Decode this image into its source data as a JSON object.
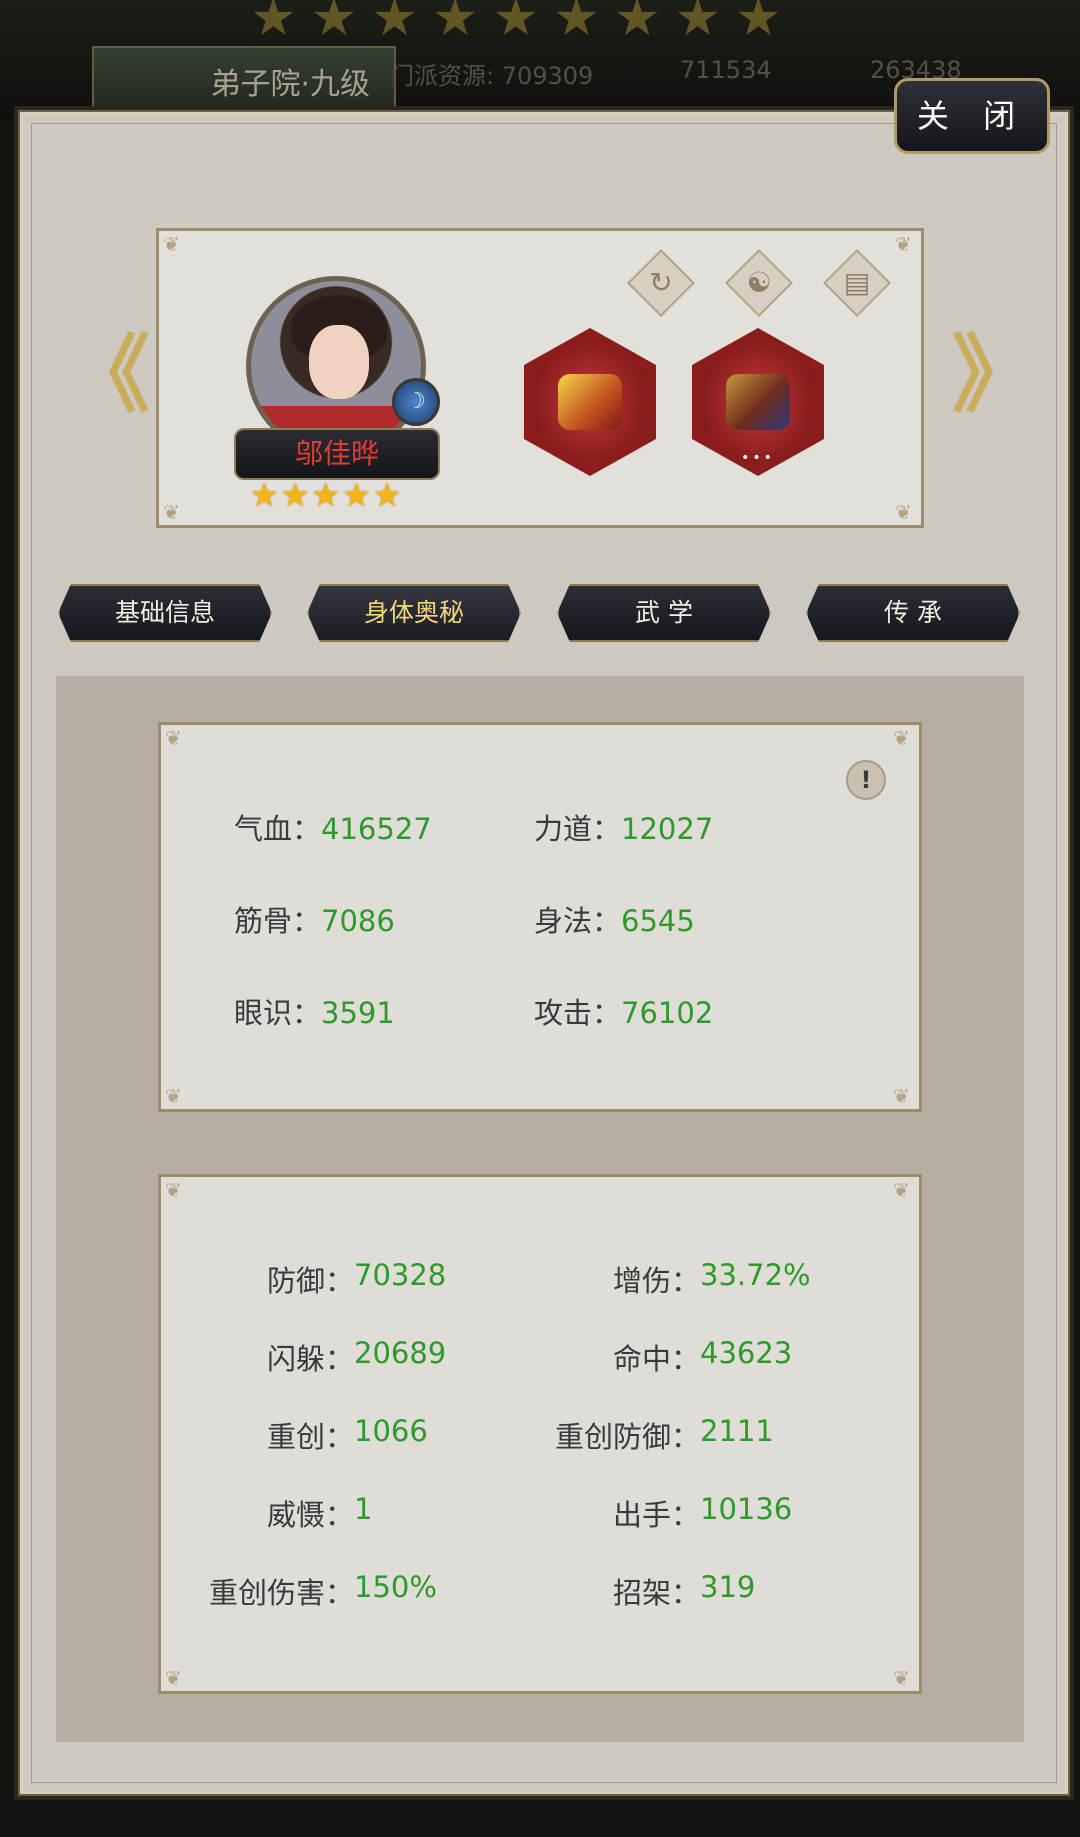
{
  "background": {
    "top_stars": [
      "★",
      "★",
      "★",
      "★",
      "★",
      "★",
      "★",
      "★",
      "★"
    ],
    "hall_tag": "弟子院·九级",
    "resources": [
      {
        "label": "门派资源: 709309"
      },
      {
        "label": "711534"
      },
      {
        "label": "263438"
      }
    ]
  },
  "close_button": "关 闭",
  "hero": {
    "name": "邬佳晔",
    "stars": [
      "★",
      "★",
      "★",
      "★",
      "★"
    ],
    "top_icons": [
      "refresh-icon",
      "yin-yang-icon",
      "book-icon"
    ],
    "equipment": [
      "weapon-icon",
      "horse-mount-icon"
    ],
    "equipment_more": "•••",
    "badge_glyph": "☽",
    "prev_arrow": "《",
    "next_arrow": "》"
  },
  "tabs": [
    {
      "label": "基础信息",
      "active": false
    },
    {
      "label": "身体奥秘",
      "active": true
    },
    {
      "label": "武  学",
      "active": false
    },
    {
      "label": "传  承",
      "active": false
    }
  ],
  "info_icon": "!",
  "primary_stats": [
    {
      "label": "气血：",
      "value": "416527"
    },
    {
      "label": "力道：",
      "value": "12027"
    },
    {
      "label": "筋骨：",
      "value": "7086"
    },
    {
      "label": "身法：",
      "value": "6545"
    },
    {
      "label": "眼识：",
      "value": "3591"
    },
    {
      "label": "攻击：",
      "value": "76102"
    }
  ],
  "secondary_stats": [
    {
      "label": "防御：",
      "value": "70328"
    },
    {
      "label": "增伤：",
      "value": "33.72%"
    },
    {
      "label": "闪躲：",
      "value": "20689"
    },
    {
      "label": "命中：",
      "value": "43623"
    },
    {
      "label": "重创：",
      "value": "1066"
    },
    {
      "label": "重创防御：",
      "value": "2111"
    },
    {
      "label": "威慑：",
      "value": " 1"
    },
    {
      "label": "出手：",
      "value": "10136"
    },
    {
      "label": "重创伤害：",
      "value": "150%"
    },
    {
      "label": "招架：",
      "value": "319"
    }
  ],
  "colors": {
    "stat_value": "#2d9a2b",
    "hero_name": "#e33a34",
    "active_tab_text": "#f4d77c",
    "panel_bg": "#cdc8c0"
  }
}
